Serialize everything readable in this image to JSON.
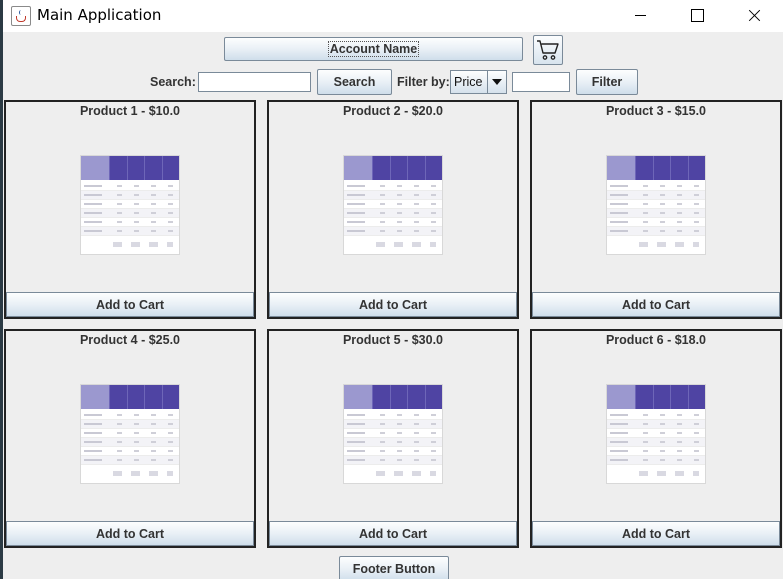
{
  "window": {
    "title": "Main Application"
  },
  "header": {
    "account_label": "Account Name",
    "cart_icon": "cart-icon"
  },
  "search": {
    "label": "Search:",
    "value": "",
    "button_label": "Search"
  },
  "filter": {
    "label": "Filter by:",
    "selected": "Price",
    "value": "",
    "button_label": "Filter"
  },
  "products": [
    {
      "name": "Product 1 - $10.0",
      "button_label": "Add to Cart"
    },
    {
      "name": "Product 2 - $20.0",
      "button_label": "Add to Cart"
    },
    {
      "name": "Product 3 - $15.0",
      "button_label": "Add to Cart"
    },
    {
      "name": "Product 4 - $25.0",
      "button_label": "Add to Cart"
    },
    {
      "name": "Product 5 - $30.0",
      "button_label": "Add to Cart"
    },
    {
      "name": "Product 6 - $18.0",
      "button_label": "Add to Cart"
    }
  ],
  "footer": {
    "button_label": "Footer Button"
  },
  "colors": {
    "thumbnail_header": "#4f44a3",
    "thumbnail_header_light": "#9b98cf",
    "button_gradient_bottom": "#cfdeeb"
  }
}
